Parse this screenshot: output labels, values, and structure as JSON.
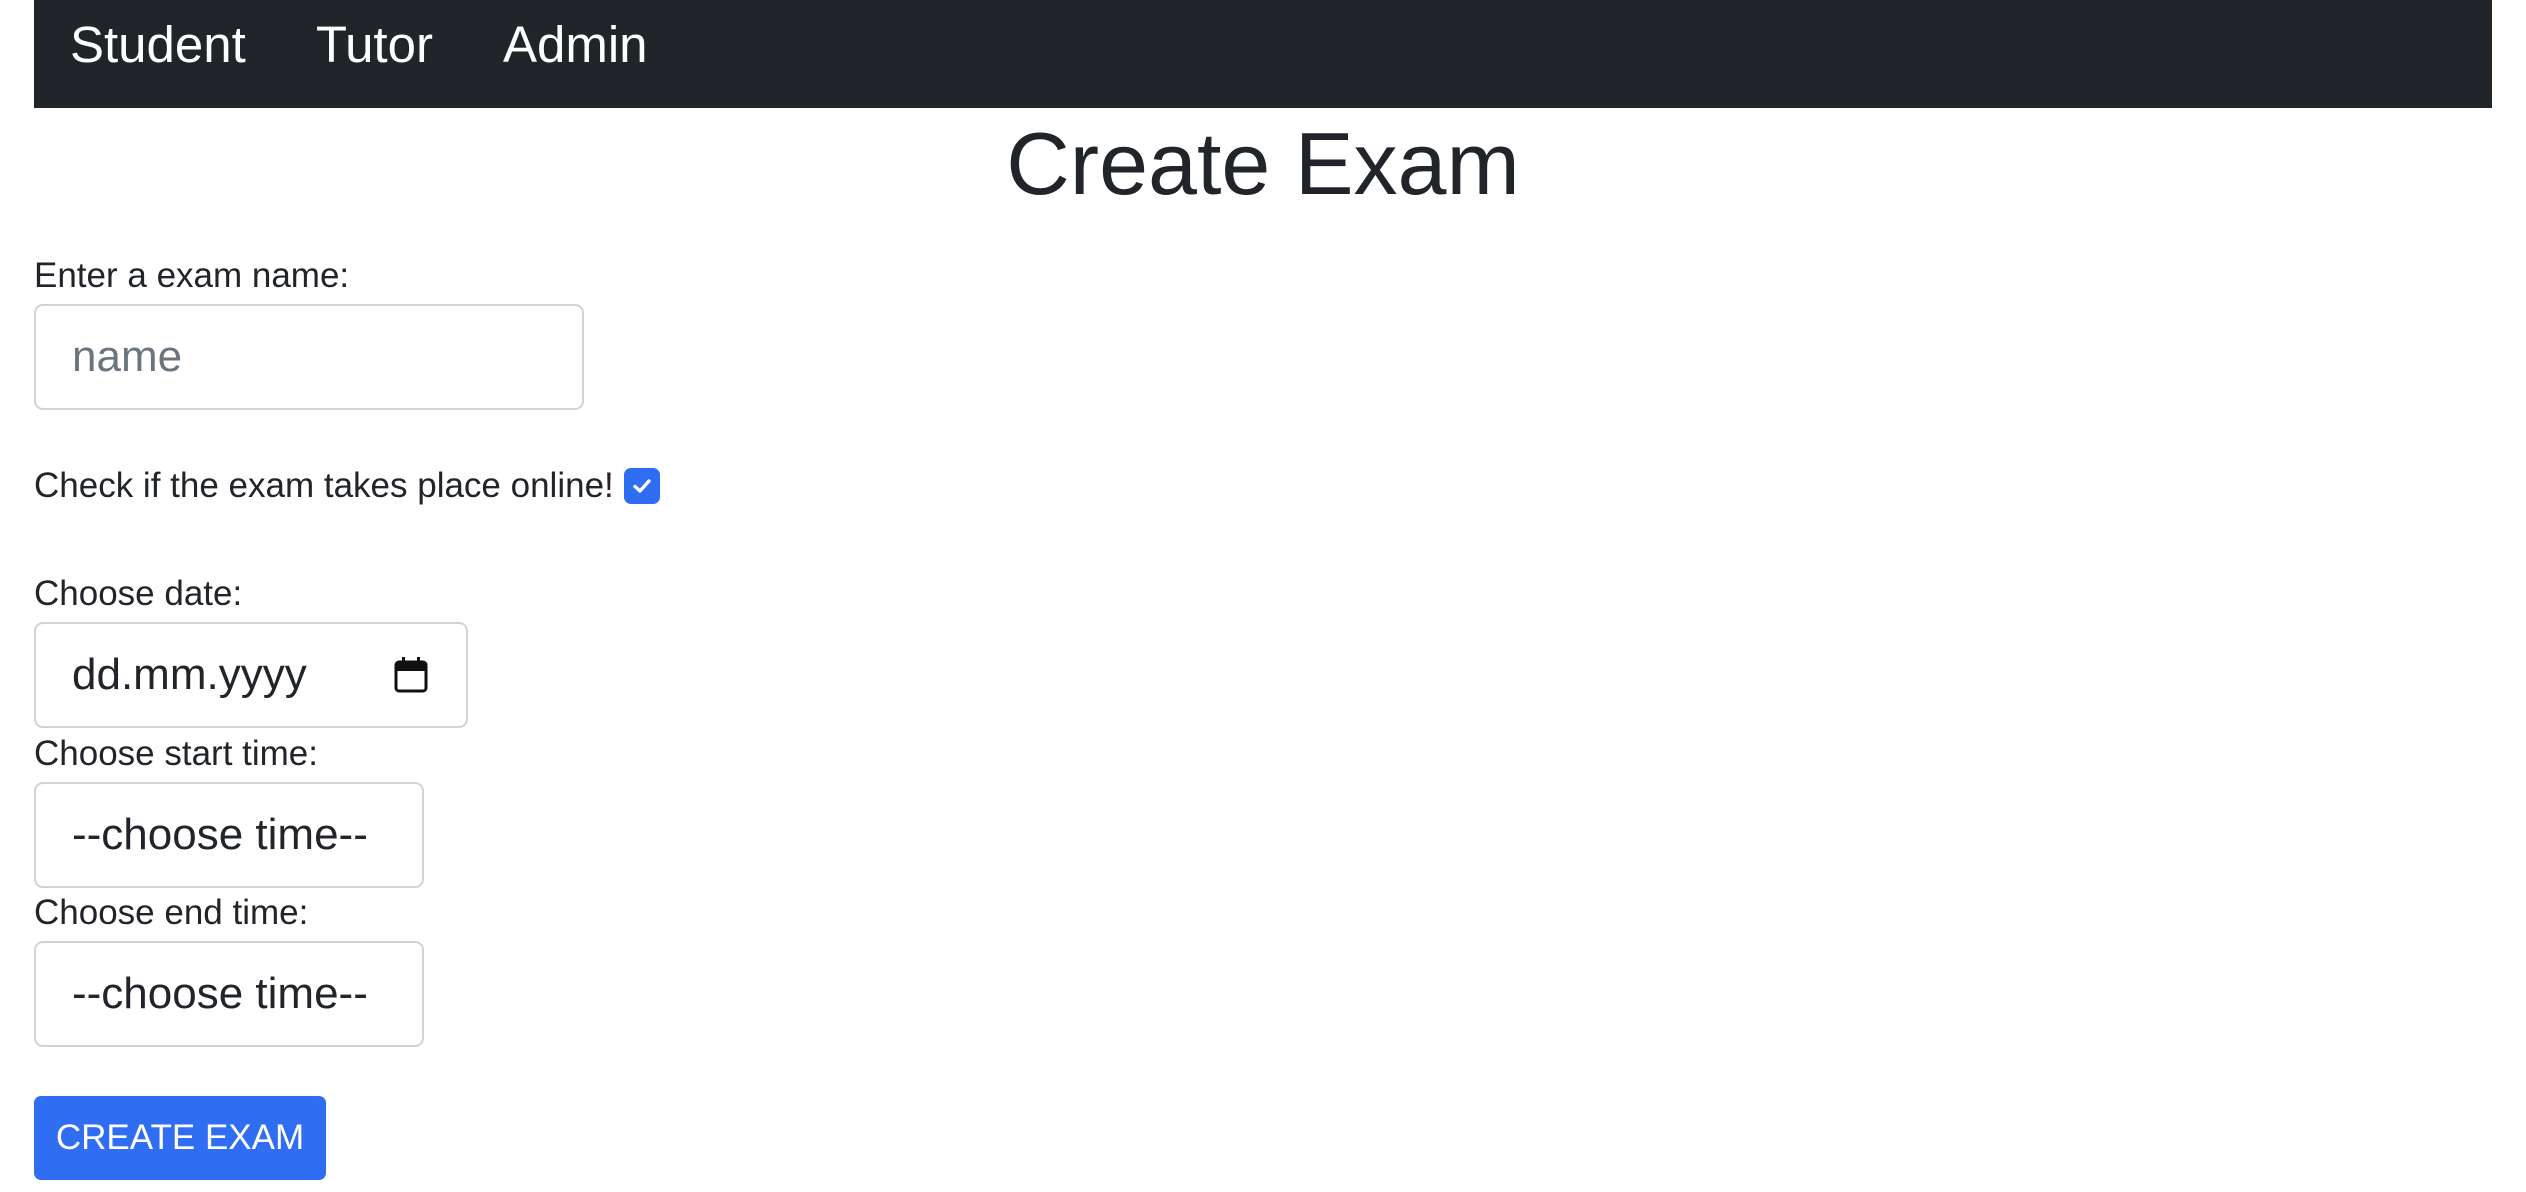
{
  "nav": {
    "items": [
      {
        "label": "Student"
      },
      {
        "label": "Tutor"
      },
      {
        "label": "Admin"
      }
    ]
  },
  "page": {
    "title": "Create Exam"
  },
  "form": {
    "name_label": "Enter a exam name:",
    "name_placeholder": "name",
    "name_value": "",
    "online_label": "Check if the exam takes place online!",
    "online_checked": true,
    "date_label": "Choose date:",
    "date_value": "dd.mm.yyyy",
    "start_time_label": "Choose start time:",
    "start_time_value": "--choose time--",
    "end_time_label": "Choose end time:",
    "end_time_value": "--choose time--",
    "submit_label": "CREATE EXAM"
  },
  "icons": {
    "checkbox": "check-icon",
    "date": "calendar-icon"
  },
  "colors": {
    "navbar": "#212529",
    "primary": "#2f6df2",
    "text": "#212529",
    "placeholder": "#6c757d",
    "border": "#ced4da"
  }
}
